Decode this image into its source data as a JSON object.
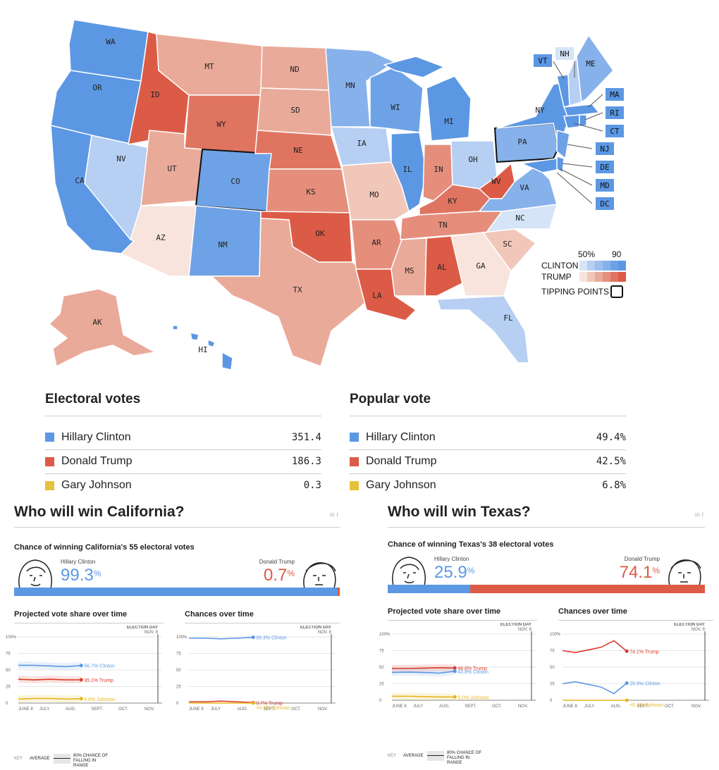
{
  "map": {
    "states": {
      "WA": "WA",
      "OR": "OR",
      "CA": "CA",
      "ID": "ID",
      "NV": "NV",
      "MT": "MT",
      "WY": "WY",
      "UT": "UT",
      "AZ": "AZ",
      "CO": "CO",
      "NM": "NM",
      "ND": "ND",
      "SD": "SD",
      "NE": "NE",
      "KS": "KS",
      "OK": "OK",
      "TX": "TX",
      "MN": "MN",
      "IA": "IA",
      "MO": "MO",
      "AR": "AR",
      "LA": "LA",
      "WI": "WI",
      "IL": "IL",
      "MS": "MS",
      "MI": "MI",
      "IN": "IN",
      "KY": "KY",
      "TN": "TN",
      "AL": "AL",
      "OH": "OH",
      "WV": "WV",
      "VA": "VA",
      "NC": "NC",
      "SC": "SC",
      "GA": "GA",
      "FL": "FL",
      "PA": "PA",
      "NY": "NY",
      "ME": "ME",
      "AK": "AK",
      "HI": "HI"
    },
    "ne_boxes": [
      "VT",
      "NH",
      "ME",
      "MA",
      "RI",
      "CT",
      "NJ",
      "DE",
      "MD",
      "DC"
    ],
    "legend": {
      "clinton_label": "CLINTON",
      "trump_label": "TRUMP",
      "scale_low": "50%",
      "scale_high": "90",
      "tipping_label": "TIPPING POINTS"
    },
    "colors": {
      "clinton_scale": [
        "#d6e4f7",
        "#b6cff2",
        "#9dbfee",
        "#86b1ea",
        "#6ea2e6",
        "#5c97e3"
      ],
      "trump_scale": [
        "#f8e3dd",
        "#f1c7ba",
        "#eaaa99",
        "#e58e7c",
        "#df7561",
        "#dc5b46"
      ]
    }
  },
  "electoral": {
    "title": "Electoral votes",
    "rows": [
      {
        "name": "Hillary Clinton",
        "value": "351.4",
        "color": "#5c97e3"
      },
      {
        "name": "Donald Trump",
        "value": "186.3",
        "color": "#dc5b46"
      },
      {
        "name": "Gary Johnson",
        "value": "0.3",
        "color": "#e6c13b"
      }
    ]
  },
  "popular": {
    "title": "Popular vote",
    "rows": [
      {
        "name": "Hillary Clinton",
        "value": "49.4%",
        "color": "#5c97e3"
      },
      {
        "name": "Donald Trump",
        "value": "42.5%",
        "color": "#dc5b46"
      },
      {
        "name": "Gary Johnson",
        "value": "6.8%",
        "color": "#e6c13b"
      }
    ]
  },
  "panels": [
    {
      "title": "Who will win California?",
      "chance_title": "Chance of winning California's 55 electoral votes",
      "clinton_name": "Hillary Clinton",
      "clinton_pct": "99.3",
      "trump_name": "Donald Trump",
      "trump_pct": "0.7",
      "pct_sign": "%",
      "share_title": "Projected vote share over time",
      "chances_title": "Chances over time",
      "election_day": "ELECTION DAY",
      "nov8": "NOV. 8",
      "key_label": "KEY",
      "key_avg": "AVERAGE",
      "key_range": "80% CHANCE OF FALLING IN RANGE"
    },
    {
      "title": "Who will win Texas?",
      "chance_title": "Chance of winning Texas's 38 electoral votes",
      "clinton_name": "Hillary Clinton",
      "clinton_pct": "25.9",
      "trump_name": "Donald Trump",
      "trump_pct": "74.1",
      "pct_sign": "%",
      "share_title": "Projected vote share over time",
      "chances_title": "Chances over time",
      "election_day": "ELECTION DAY",
      "nov8": "NOV. 8",
      "key_label": "KEY",
      "key_avg": "AVERAGE",
      "key_range": "80% CHANCE OF FALLING IN RANGE"
    }
  ],
  "chart_data": [
    {
      "type": "line",
      "title": "Projected vote share over time",
      "state": "California",
      "x": [
        "JUNE 8",
        "JULY",
        "AUG.",
        "SEPT.",
        "OCT.",
        "NOV."
      ],
      "ylim": [
        0,
        100
      ],
      "yticks": [
        "100%",
        "75",
        "50",
        "25",
        "0"
      ],
      "series": [
        {
          "name": "Clinton",
          "label": "56.7% Clinton",
          "color": "#5c97e3",
          "values": [
            57,
            57,
            56,
            55,
            56.7
          ]
        },
        {
          "name": "Trump",
          "label": "35.1% Trump",
          "color": "#dc3a2a",
          "values": [
            36,
            35,
            36,
            35,
            35.1
          ]
        },
        {
          "name": "Johnson",
          "label": "6.6% Johnson",
          "color": "#e6b71e",
          "values": [
            6,
            7,
            7,
            6,
            6.6
          ]
        }
      ]
    },
    {
      "type": "line",
      "title": "Chances over time",
      "state": "California",
      "x": [
        "JUNE 8",
        "JULY",
        "AUG.",
        "SEPT.",
        "OCT.",
        "NOV."
      ],
      "ylim": [
        0,
        100
      ],
      "yticks": [
        "100%",
        "75",
        "50",
        "25",
        "0"
      ],
      "series": [
        {
          "name": "Clinton",
          "label": "99.3% Clinton",
          "color": "#5c97e3",
          "values": [
            98,
            98,
            97,
            98,
            99.3
          ]
        },
        {
          "name": "Trump",
          "label": "0.7% Trump",
          "color": "#dc3a2a",
          "values": [
            2,
            2,
            3,
            2,
            0.7
          ]
        },
        {
          "name": "Johnson",
          "label": "<0.1% Johnson",
          "color": "#e6b71e",
          "values": [
            0,
            0,
            0,
            0,
            0
          ]
        }
      ]
    },
    {
      "type": "line",
      "title": "Projected vote share over time",
      "state": "Texas",
      "x": [
        "JUNE 8",
        "JULY",
        "AUG.",
        "SEPT.",
        "OCT.",
        "NOV."
      ],
      "ylim": [
        0,
        100
      ],
      "yticks": [
        "100%",
        "75",
        "50",
        "25",
        "0"
      ],
      "series": [
        {
          "name": "Trump",
          "label": "48.8% Trump",
          "color": "#dc3a2a",
          "values": [
            48,
            48,
            48.5,
            49,
            48.8
          ]
        },
        {
          "name": "Clinton",
          "label": "43.8% Clinton",
          "color": "#5c97e3",
          "values": [
            42,
            42.5,
            42,
            41,
            43.8
          ]
        },
        {
          "name": "Johnson",
          "label": "5.0% Johnson",
          "color": "#e6b71e",
          "values": [
            6,
            6,
            5.5,
            5,
            5.0
          ]
        }
      ]
    },
    {
      "type": "line",
      "title": "Chances over time",
      "state": "Texas",
      "x": [
        "JUNE 8",
        "JULY",
        "AUG.",
        "SEPT.",
        "OCT.",
        "NOV."
      ],
      "ylim": [
        0,
        100
      ],
      "yticks": [
        "100%",
        "75",
        "50",
        "25",
        "0"
      ],
      "series": [
        {
          "name": "Trump",
          "label": "74.1% Trump",
          "color": "#dc3a2a",
          "values": [
            75,
            72,
            76,
            80,
            90,
            74.1
          ]
        },
        {
          "name": "Clinton",
          "label": "25.9% Clinton",
          "color": "#5c97e3",
          "values": [
            25,
            28,
            24,
            20,
            10,
            25.9
          ]
        },
        {
          "name": "Johnson",
          "label": "<0.1% Johnson",
          "color": "#e6b71e",
          "values": [
            0,
            0,
            0,
            0,
            0,
            0
          ]
        }
      ]
    }
  ]
}
